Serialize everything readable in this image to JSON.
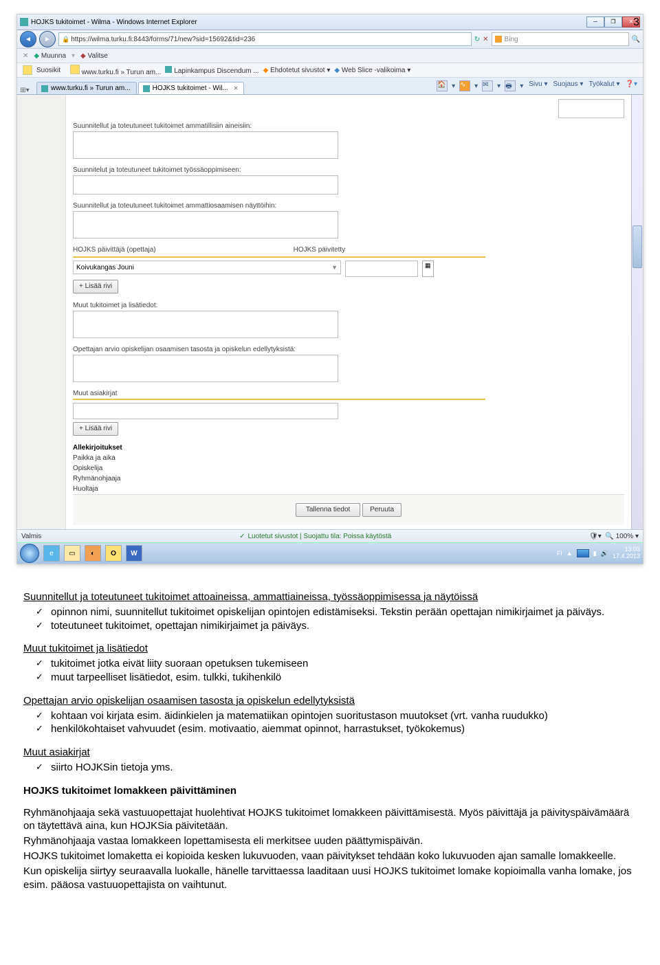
{
  "page_number": "3",
  "window": {
    "title": "HOJKS tukitoimet - Wilma - Windows Internet Explorer",
    "url": "https://wilma.turku.fi:8443/forms/71/new?sid=15692&tid=236",
    "search_placeholder": "Bing",
    "toolbar1": {
      "muunna": "Muunna",
      "valitse": "Valitse"
    },
    "favbar": {
      "suosikit": "Suosikit",
      "link1": "www.turku.fi » Turun am...",
      "link2": "Lapinkampus Discendum ...",
      "link3": "Ehdotetut sivustot",
      "link4": "Web Slice -valikoima"
    },
    "tabs": {
      "tab1": "www.turku.fi » Turun am...",
      "tab2": "HOJKS tukitoimet - Wil..."
    },
    "menus": {
      "sivu": "Sivu",
      "suojaus": "Suojaus",
      "tyokalut": "Työkalut"
    }
  },
  "form": {
    "lbl_amm_aineisiin": "Suunnitellut ja toteutuneet tukitoimet ammatillisiin aineisiin:",
    "lbl_tyossa": "Suunnitelut ja toteutuneet tukitoimet työssäoppimiseen:",
    "lbl_nayttoihin": "Suunnitellut ja toteutuneet tukitoimet ammattiosaamisen näyttöihin:",
    "lbl_paivittaja": "HOJKS päivittäjä (opettaja)",
    "lbl_paivitetty": "HOJKS päivitetty",
    "paivittaja_value": "Koivukangas Jouni",
    "btn_lisaa": "+ Lisää rivi",
    "lbl_muut_tuki": "Muut tukitoimet ja lisätiedot:",
    "lbl_arvio": "Opettajan arvio opiskelijan osaamisen tasosta ja opiskelun edellytyksistä:",
    "lbl_muut_asiak": "Muut asiakirjat",
    "sig_title": "Allekirjoitukset",
    "sig_paikka": "Paikka ja aika",
    "sig_opisk": "Opiskelija",
    "sig_ryhma": "Ryhmänohjaaja",
    "sig_huolt": "Huoltaja",
    "btn_tallenna": "Tallenna tiedot",
    "btn_peruuta": "Peruuta"
  },
  "status": {
    "valmis": "Valmis",
    "luotetut": "Luotetut sivustot | Suojattu tila: Poissa käytöstä",
    "zoom": "100%"
  },
  "taskbar": {
    "lang": "FI",
    "time": "13:03",
    "date": "17.4.2013"
  },
  "doc": {
    "h1": "Suunnitellut ja toteutuneet tukitoimet attoaineissa, ammattiaineissa, työssäoppimisessa ja näytöissä",
    "l1a": "opinnon nimi, suunnitellut tukitoimet opiskelijan opintojen edistämiseksi. Tekstin perään opettajan nimikirjaimet ja päiväys.",
    "l1b": "toteutuneet tukitoimet, opettajan nimikirjaimet ja päiväys.",
    "h2": "Muut tukitoimet ja lisätiedot",
    "l2a": "tukitoimet jotka eivät liity suoraan opetuksen tukemiseen",
    "l2b": "muut tarpeelliset lisätiedot, esim. tulkki, tukihenkilö",
    "h3": "Opettajan arvio opiskelijan osaamisen tasosta ja opiskelun edellytyksistä",
    "l3a": "kohtaan voi kirjata esim. äidinkielen ja matematiikan opintojen suoritustason muutokset (vrt. vanha ruudukko)",
    "l3b": "henkilökohtaiset vahvuudet (esim. motivaatio, aiemmat opinnot, harrastukset, työkokemus)",
    "h4": "Muut asiakirjat",
    "l4a": "siirto HOJKSin tietoja yms.",
    "h5": "HOJKS tukitoimet lomakkeen päivittäminen",
    "p1": "Ryhmänohjaaja sekä vastuuopettajat huolehtivat HOJKS tukitoimet lomakkeen päivittämisestä. Myös päivittäjä ja päivityspäivämäärä on täytettävä aina, kun HOJKSia päivitetään.",
    "p2": "Ryhmänohjaaja vastaa lomakkeen lopettamisesta eli merkitsee uuden päättymispäivän.",
    "p3": "HOJKS tukitoimet lomaketta ei kopioida kesken lukuvuoden, vaan päivitykset tehdään koko lukuvuoden ajan samalle lomakkeelle.",
    "p4": "Kun opiskelija siirtyy seuraavalla luokalle, hänelle tarvittaessa laaditaan uusi HOJKS tukitoimet lomake kopioimalla vanha lomake, jos esim. pääosa vastuuopettajista on vaihtunut."
  }
}
